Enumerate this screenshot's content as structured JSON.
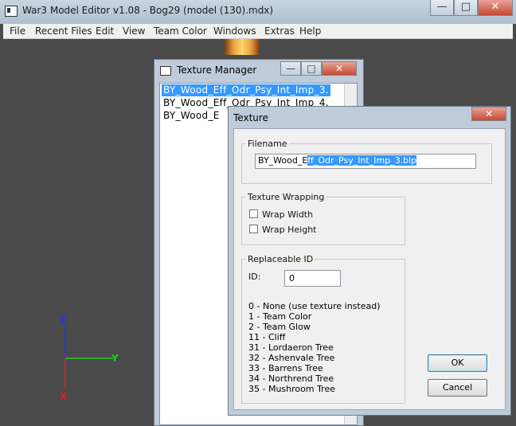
{
  "main_window": {
    "title": "War3 Model Editor v1.08 - Bog29 (model (130).mdx)",
    "controls": {
      "minimize": "—",
      "maximize": "□",
      "close": "✕"
    }
  },
  "menu": [
    {
      "label": "File"
    },
    {
      "label": "Recent Files"
    },
    {
      "label": "Edit"
    },
    {
      "label": "View"
    },
    {
      "label": "Team Color"
    },
    {
      "label": "Windows"
    },
    {
      "label": "Extras"
    },
    {
      "label": "Help"
    }
  ],
  "axes": {
    "x": "X",
    "y": "Y",
    "z": "Z"
  },
  "texture_manager": {
    "title": "Texture Manager",
    "items": [
      "BY_Wood_Eff_Odr_Psy_Int_Imp_3.",
      "BY_Wood_Eff_Odr_Psy_Int_Imp_4.",
      "BY_Wood_E"
    ],
    "selected_index": 0
  },
  "texture_dialog": {
    "title": "Texture",
    "filename": {
      "legend": "Filename",
      "value_prefix": "BY_Wood_E",
      "value_selected": "ff_Odr_Psy_Int_Imp_3.blp"
    },
    "wrapping": {
      "legend": "Texture Wrapping",
      "wrap_width": {
        "label": "Wrap Width",
        "checked": false
      },
      "wrap_height": {
        "label": "Wrap Height",
        "checked": false
      }
    },
    "replaceable": {
      "legend": "Replaceable ID",
      "id_label": "ID:",
      "id_value": "0",
      "options": [
        "0 - None (use texture instead)",
        "1 - Team Color",
        "2 - Team Glow",
        "11 - Cliff",
        "31 - Lordaeron Tree",
        "32 - Ashenvale Tree",
        "33 - Barrens Tree",
        "34 - Northrend Tree",
        "35 - Mushroom Tree"
      ]
    },
    "ok_label": "OK",
    "cancel_label": "Cancel"
  }
}
